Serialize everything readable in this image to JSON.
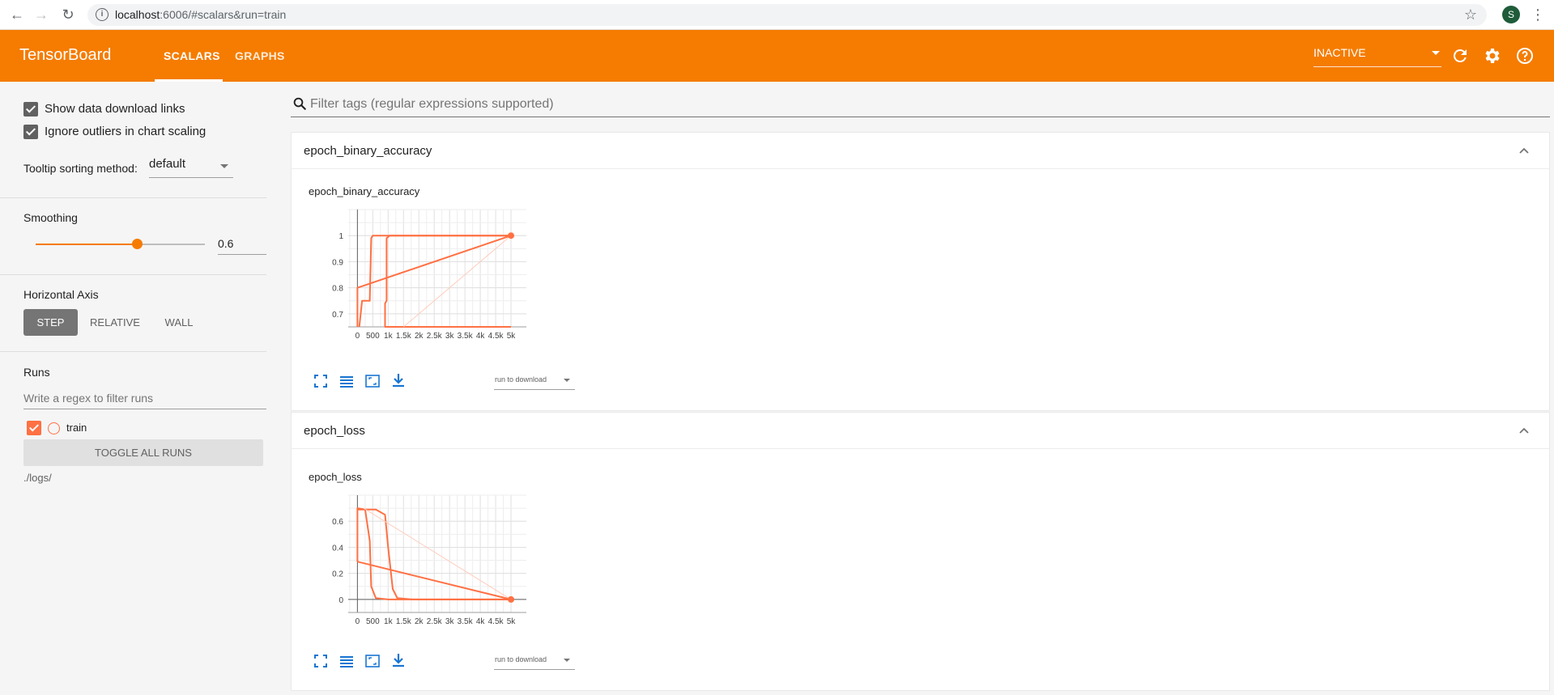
{
  "browser": {
    "url_host": "localhost",
    "url_rest": ":6006/#scalars&run=train",
    "profile_initial": "S"
  },
  "header": {
    "logo": "TensorBoard",
    "tabs": [
      {
        "label": "SCALARS",
        "active": true
      },
      {
        "label": "GRAPHS",
        "active": false
      }
    ],
    "reload_status": "INACTIVE",
    "accent_color": "#f57c00"
  },
  "sidebar": {
    "show_download_links": "Show data download links",
    "ignore_outliers": "Ignore outliers in chart scaling",
    "tooltip_sort_label": "Tooltip sorting method:",
    "tooltip_sort_value": "default",
    "smoothing_title": "Smoothing",
    "smoothing_value": "0.6",
    "smoothing_fraction": 0.6,
    "horizontal_axis_title": "Horizontal Axis",
    "axis_options": [
      "STEP",
      "RELATIVE",
      "WALL"
    ],
    "axis_selected": "STEP",
    "runs_title": "Runs",
    "runs_filter_placeholder": "Write a regex to filter runs",
    "runs": [
      {
        "name": "train",
        "color": "#ff7043",
        "checked": true
      }
    ],
    "toggle_all": "TOGGLE ALL RUNS",
    "logdir": "./logs/"
  },
  "main": {
    "filter_placeholder": "Filter tags (regular expressions supported)",
    "cards": [
      {
        "title": "epoch_binary_accuracy",
        "chart_title": "epoch_binary_accuracy",
        "download_placeholder": "run to download"
      },
      {
        "title": "epoch_loss",
        "chart_title": "epoch_loss",
        "download_placeholder": "run to download"
      }
    ]
  },
  "chart_data": [
    {
      "type": "line",
      "title": "epoch_binary_accuracy",
      "xlabel": "",
      "ylabel": "",
      "x_ticks": [
        "0",
        "500",
        "1k",
        "1.5k",
        "2k",
        "2.5k",
        "3k",
        "3.5k",
        "4k",
        "4.5k",
        "5k"
      ],
      "y_ticks": [
        "0.7",
        "0.8",
        "0.9",
        "1"
      ],
      "xlim": [
        -300,
        5500
      ],
      "ylim": [
        0.65,
        1.1
      ],
      "series": [
        {
          "name": "train",
          "style": "smoothed",
          "color": "#ff7043",
          "x": [
            0,
            0,
            5000,
            1050,
            950,
            950,
            900,
            900,
            5000
          ],
          "y": [
            0.65,
            0.8,
            1.0,
            1.0,
            0.99,
            0.75,
            0.74,
            0.65,
            0.65
          ]
        },
        {
          "name": "train",
          "style": "smoothed",
          "color": "#ff7043",
          "x": [
            60,
            150,
            400,
            450,
            500,
            600,
            5000
          ],
          "y": [
            0.65,
            0.75,
            0.75,
            0.99,
            1.0,
            1.0,
            1.0
          ]
        },
        {
          "name": "train",
          "style": "raw",
          "color": "#ffccbc",
          "x": [
            1500,
            5000
          ],
          "y": [
            0.65,
            1.0
          ]
        }
      ]
    },
    {
      "type": "line",
      "title": "epoch_loss",
      "xlabel": "",
      "ylabel": "",
      "x_ticks": [
        "0",
        "500",
        "1k",
        "1.5k",
        "2k",
        "2.5k",
        "3k",
        "3.5k",
        "4k",
        "4.5k",
        "5k"
      ],
      "y_ticks": [
        "0",
        "0.2",
        "0.4",
        "0.6"
      ],
      "xlim": [
        -300,
        5500
      ],
      "ylim": [
        -0.1,
        0.8
      ],
      "series": [
        {
          "name": "train",
          "style": "smoothed",
          "color": "#ff7043",
          "x": [
            0,
            0,
            250,
            400,
            450,
            600,
            1000,
            5000
          ],
          "y": [
            0.29,
            0.7,
            0.69,
            0.45,
            0.1,
            0.01,
            0.0,
            0.0
          ]
        },
        {
          "name": "train",
          "style": "smoothed",
          "color": "#ff7043",
          "x": [
            0,
            600,
            900,
            1000,
            1150,
            1300,
            1800,
            5000
          ],
          "y": [
            0.69,
            0.69,
            0.65,
            0.4,
            0.08,
            0.01,
            0.0,
            0.0
          ]
        },
        {
          "name": "train",
          "style": "smoothed",
          "color": "#ff7043",
          "x": [
            0,
            5000
          ],
          "y": [
            0.29,
            0.0
          ]
        },
        {
          "name": "train",
          "style": "raw",
          "color": "#ffccbc",
          "x": [
            200,
            5000
          ],
          "y": [
            0.7,
            0.0
          ]
        }
      ]
    }
  ]
}
